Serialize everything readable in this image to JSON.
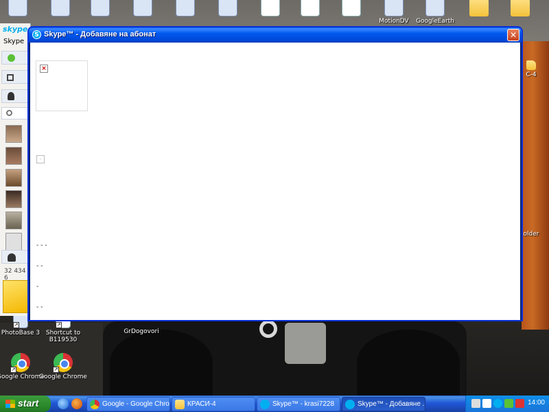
{
  "desktop": {
    "icons_top": [
      {
        "name": "top-icon-1",
        "kind": "generic",
        "label": ""
      },
      {
        "name": "top-icon-2",
        "kind": "generic",
        "label": ""
      },
      {
        "name": "top-icon-firefox",
        "kind": "generic",
        "label": ""
      },
      {
        "name": "top-icon-avira",
        "kind": "generic",
        "label": ""
      },
      {
        "name": "top-icon-app",
        "kind": "generic",
        "label": ""
      },
      {
        "name": "top-icon-notepad",
        "kind": "generic",
        "label": ""
      },
      {
        "name": "top-icon-excel",
        "kind": "doc",
        "label": ""
      },
      {
        "name": "top-icon-word-1",
        "kind": "doc",
        "label": ""
      },
      {
        "name": "top-icon-word-2",
        "kind": "doc",
        "label": ""
      },
      {
        "name": "top-icon-motiondv",
        "kind": "generic",
        "label": "MotionDV"
      },
      {
        "name": "top-icon-googleearth",
        "kind": "generic",
        "label": "GoogleEarth"
      },
      {
        "name": "top-icon-folder-1",
        "kind": "folder",
        "label": ""
      },
      {
        "name": "top-icon-folder-2",
        "kind": "folder",
        "label": ""
      }
    ],
    "icons_bottom": [
      {
        "name": "photobase-icon",
        "label": "PhotoBase 3"
      },
      {
        "name": "shortcut-b119530-icon",
        "label": "Shortcut to B119530"
      },
      {
        "name": "grdogovori-icon",
        "label": "GrDogovori"
      },
      {
        "name": "google-chrome-icon-1",
        "label": "Google Chrome"
      },
      {
        "name": "google-chrome-icon-2",
        "label": "Google Chrome"
      }
    ],
    "right_fragments": [
      "C-4",
      "older"
    ]
  },
  "skype_main": {
    "logo": "skype",
    "menu_text": "Skype",
    "count_text": "32 434 6"
  },
  "dialog": {
    "title": "Skype™ - Добавяне на абонат",
    "close_symbol": "✕",
    "dash_lines": [
      "- - -",
      "- -",
      "-",
      "- -"
    ]
  },
  "taskbar": {
    "start_label": "start",
    "tasks": [
      {
        "label": "Google - Google Chrome",
        "icon": "chrome-icon",
        "active": false
      },
      {
        "label": "КРАСИ-4",
        "icon": "folder-icon",
        "active": false
      },
      {
        "label": "Skype™ - krasi7228",
        "icon": "skype-icon",
        "active": false
      },
      {
        "label": "Skype™ - Добавяне ...",
        "icon": "skype-icon",
        "active": true
      }
    ],
    "clock": "14:00"
  }
}
